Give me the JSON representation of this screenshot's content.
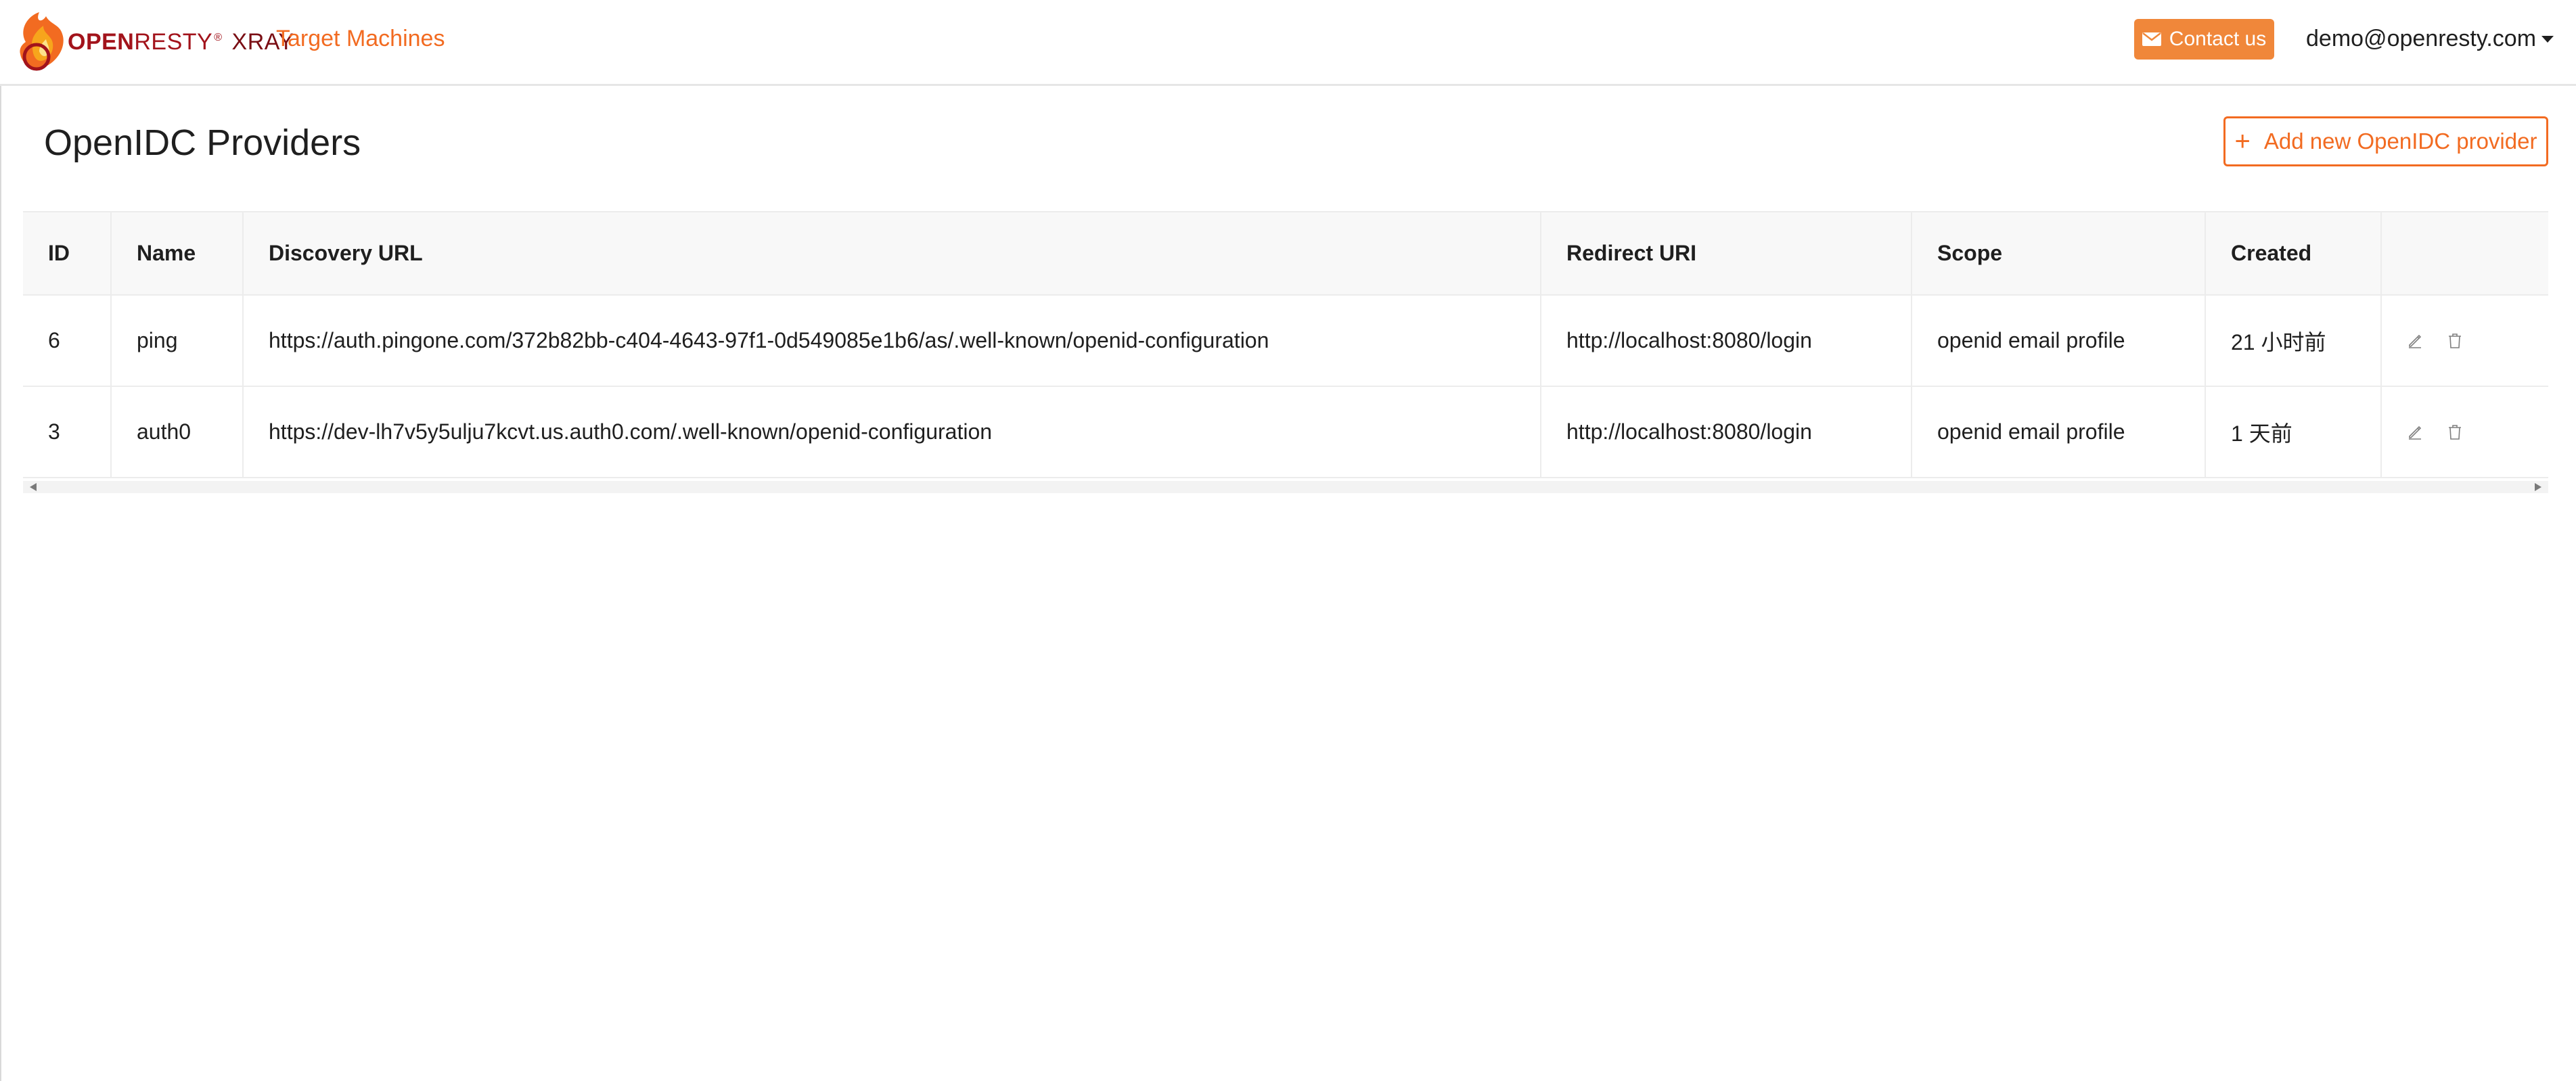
{
  "brand": {
    "part1": "OPEN",
    "part2": "RESTY",
    "registered": "®",
    "product": "XRAY"
  },
  "nav": {
    "link": "Target Machines"
  },
  "header": {
    "contact_label": "Contact us",
    "user_email": "demo@openresty.com"
  },
  "page": {
    "title": "OpenIDC Providers",
    "add_button_label": "Add new OpenIDC provider"
  },
  "table": {
    "columns": [
      "ID",
      "Name",
      "Discovery URL",
      "Redirect URI",
      "Scope",
      "Created",
      ""
    ],
    "rows": [
      {
        "id": "6",
        "name": "ping",
        "discovery_url": "https://auth.pingone.com/372b82bb-c404-4643-97f1-0d549085e1b6/as/.well-known/openid-configuration",
        "redirect_uri": "http://localhost:8080/login",
        "scope": "openid email profile",
        "created": "21 小时前"
      },
      {
        "id": "3",
        "name": "auth0",
        "discovery_url": "https://dev-lh7v5y5ulju7kcvt.us.auth0.com/.well-known/openid-configuration",
        "redirect_uri": "http://localhost:8080/login",
        "scope": "openid email profile",
        "created": "1 天前"
      }
    ]
  },
  "icons": {
    "logo": "openresty-flame-logo",
    "mail": "envelope-icon",
    "plus": "plus-icon",
    "edit": "pencil-icon",
    "delete": "trash-icon"
  },
  "colors": {
    "accent": "#f26b21",
    "contact_bg": "#f0873a",
    "brand_red": "#a2131b"
  }
}
